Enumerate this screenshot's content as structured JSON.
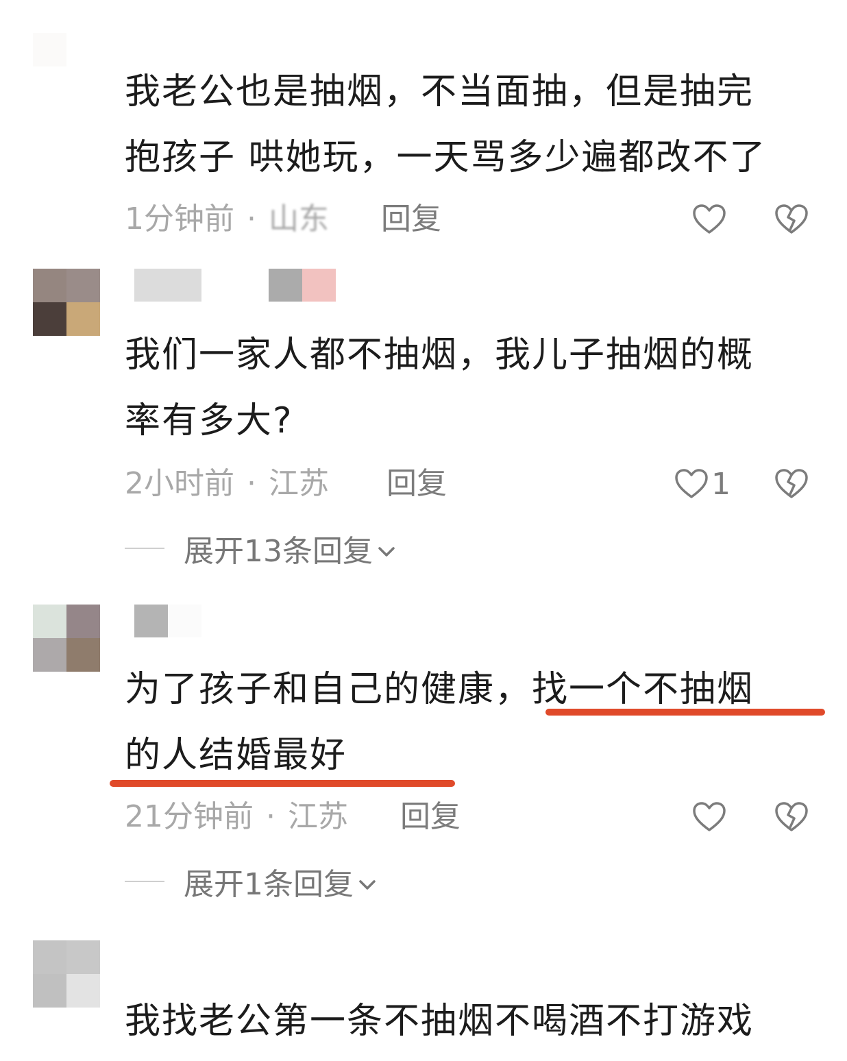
{
  "colors": {
    "highlight_underline": "#e04a2a",
    "meta_text": "#a8a8a8",
    "action_text": "#7c7c7c"
  },
  "comments": [
    {
      "lines": [
        "我老公也是抽烟，不当面抽，但是抽完",
        "抱孩子 哄她玩，一天骂多少遍都改不了"
      ],
      "time": "1分钟前",
      "region": "山东",
      "reply_label": "回复",
      "like_icon": "heart-outline-icon",
      "like_count": "",
      "dislike_icon": "broken-heart-icon"
    },
    {
      "lines": [
        "我们一家人都不抽烟，我儿子抽烟的概",
        "率有多大?"
      ],
      "time": "2小时前",
      "region": "江苏",
      "reply_label": "回复",
      "like_icon": "heart-outline-icon",
      "like_count": "1",
      "dislike_icon": "broken-heart-icon",
      "expand_label": "展开13条回复"
    },
    {
      "lines": [
        "为了孩子和自己的健康，找一个不抽烟",
        "的人结婚最好"
      ],
      "highlighted_text": "找一个不抽烟的人结婚最好",
      "time": "21分钟前",
      "region": "江苏",
      "reply_label": "回复",
      "like_icon": "heart-outline-icon",
      "like_count": "",
      "dislike_icon": "broken-heart-icon",
      "expand_label": "展开1条回复"
    },
    {
      "lines": [
        "我找老公第一条不抽烟不喝酒不打游戏"
      ]
    }
  ],
  "separator": "·"
}
